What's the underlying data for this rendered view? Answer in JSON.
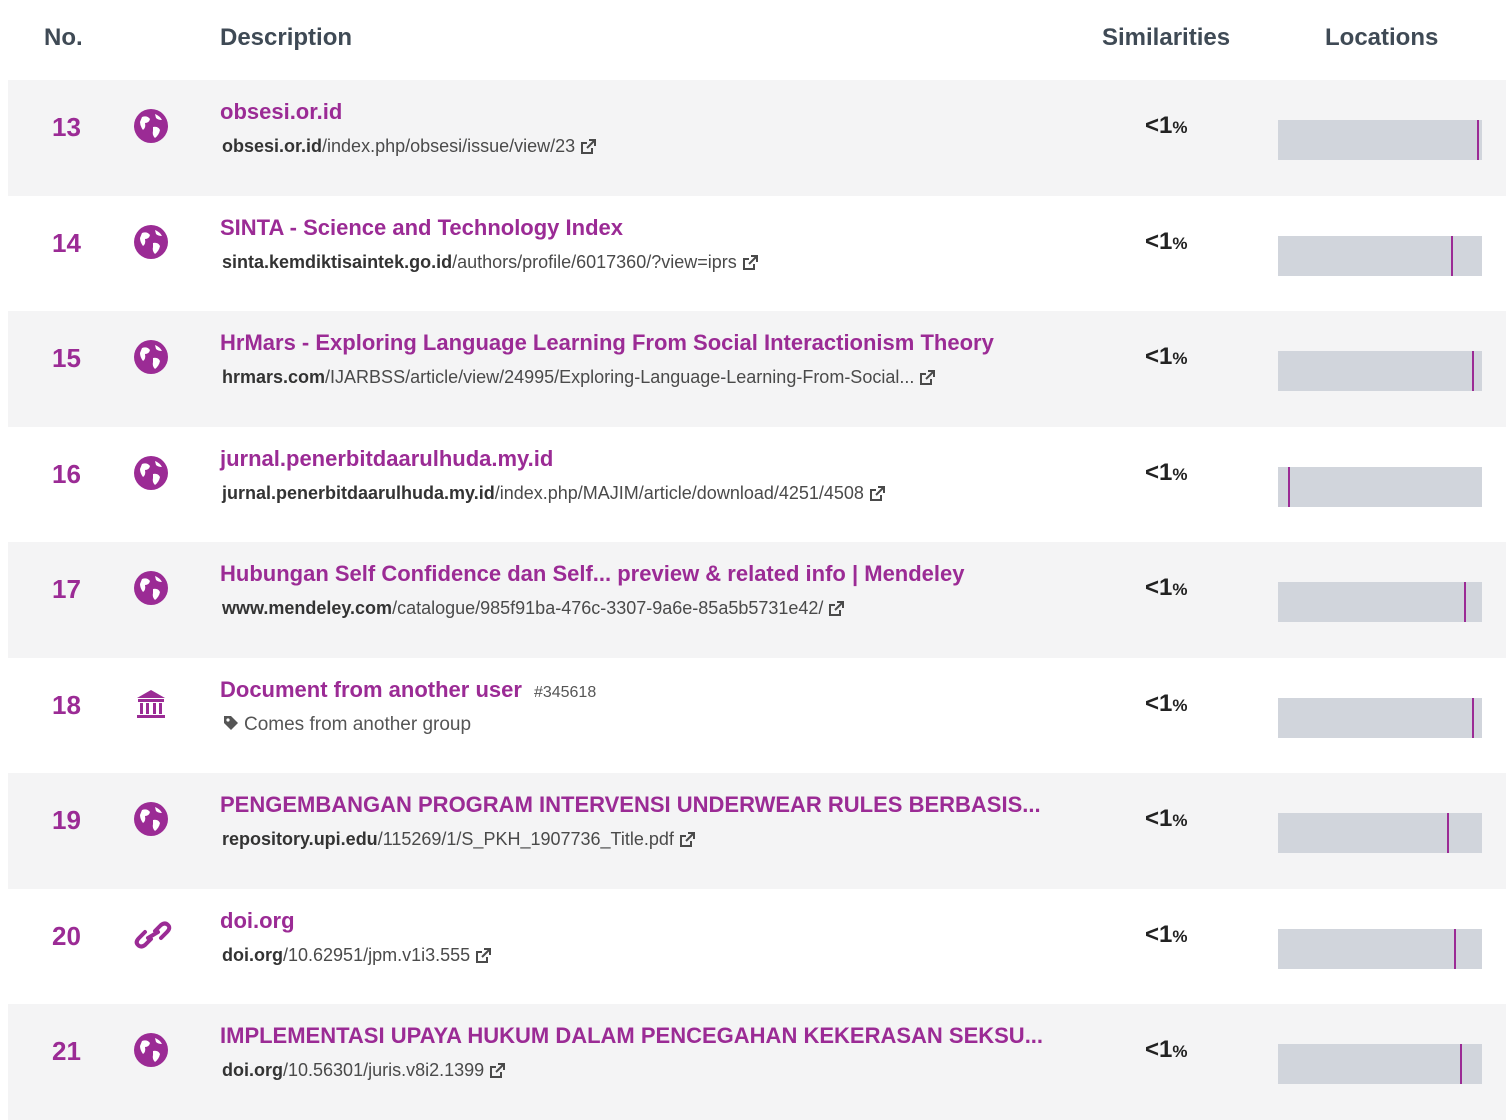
{
  "headers": {
    "no": "No.",
    "description": "Description",
    "similarities": "Similarities",
    "locations": "Locations"
  },
  "colors": {
    "accent": "#9b2b95",
    "bar": "#d1d5dc",
    "shade": "#f4f4f5"
  },
  "rows": [
    {
      "no": "13",
      "icon": "globe-icon",
      "title": "obsesi.or.id",
      "domain": "obsesi.or.id",
      "path": "/index.php/obsesi/issue/view/23",
      "sim_value": "<1",
      "sim_unit": "%",
      "location_fraction": 0.985
    },
    {
      "no": "14",
      "icon": "globe-icon",
      "title": "SINTA - Science and Technology Index",
      "domain": "sinta.kemdiktisaintek.go.id",
      "path": "/authors/profile/6017360/?view=iprs",
      "sim_value": "<1",
      "sim_unit": "%",
      "location_fraction": 0.855
    },
    {
      "no": "15",
      "icon": "globe-icon",
      "title": "HrMars - Exploring Language Learning From Social Interactionism Theory",
      "domain": "hrmars.com",
      "path": "/IJARBSS/article/view/24995/Exploring-Language-Learning-From-Social...",
      "sim_value": "<1",
      "sim_unit": "%",
      "location_fraction": 0.96
    },
    {
      "no": "16",
      "icon": "globe-icon",
      "title": "jurnal.penerbitdaarulhuda.my.id",
      "domain": "jurnal.penerbitdaarulhuda.my.id",
      "path": "/index.php/MAJIM/article/download/4251/4508",
      "sim_value": "<1",
      "sim_unit": "%",
      "location_fraction": 0.05
    },
    {
      "no": "17",
      "icon": "globe-icon",
      "title": "Hubungan Self Confidence dan Self... preview & related info | Mendeley",
      "domain": "www.mendeley.com",
      "path": "/catalogue/985f91ba-476c-3307-9a6e-85a5b5731e42/",
      "sim_value": "<1",
      "sim_unit": "%",
      "location_fraction": 0.92
    },
    {
      "no": "18",
      "icon": "institution-icon",
      "title": "Document from another user",
      "tag": "#345618",
      "group_label": "Comes from another group",
      "sim_value": "<1",
      "sim_unit": "%",
      "location_fraction": 0.96
    },
    {
      "no": "19",
      "icon": "globe-icon",
      "title": "PENGEMBANGAN PROGRAM INTERVENSI UNDERWEAR RULES BERBASIS...",
      "domain": "repository.upi.edu",
      "path": "/115269/1/S_PKH_1907736_Title.pdf",
      "sim_value": "<1",
      "sim_unit": "%",
      "location_fraction": 0.835
    },
    {
      "no": "20",
      "icon": "link-icon",
      "title": "doi.org",
      "domain": "doi.org",
      "path": "/10.62951/jpm.v1i3.555",
      "sim_value": "<1",
      "sim_unit": "%",
      "location_fraction": 0.87
    },
    {
      "no": "21",
      "icon": "globe-icon",
      "title": "IMPLEMENTASI UPAYA HUKUM DALAM PENCEGAHAN KEKERASAN SEKSU...",
      "domain": "doi.org",
      "path": "/10.56301/juris.v8i2.1399",
      "sim_value": "<1",
      "sim_unit": "%",
      "location_fraction": 0.9
    }
  ]
}
